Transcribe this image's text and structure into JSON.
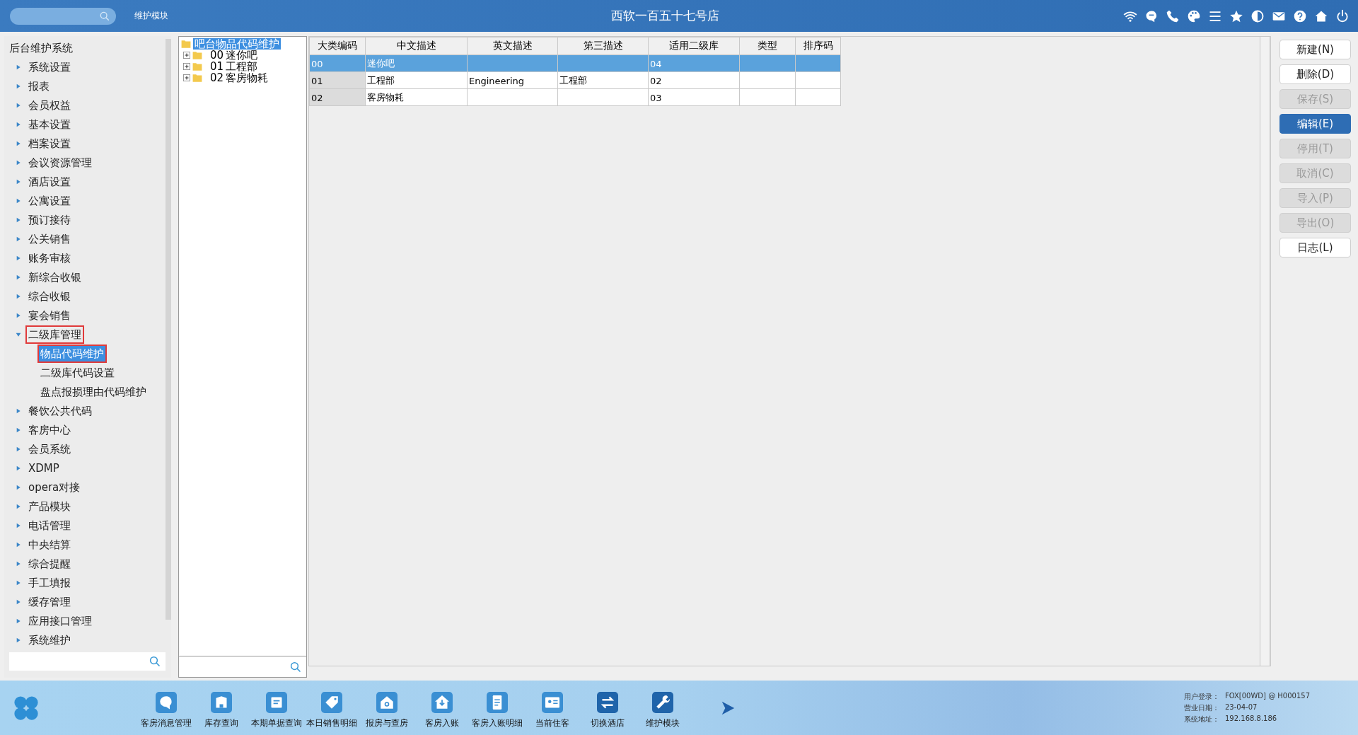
{
  "top_bar": {
    "module": "维护模块",
    "title": "西软一百五十七号店"
  },
  "sidebar": {
    "title": "后台维护系统",
    "items": [
      {
        "label": "系统设置",
        "expanded": false,
        "marked": false
      },
      {
        "label": "报表",
        "expanded": false,
        "marked": false
      },
      {
        "label": "会员权益",
        "expanded": false,
        "marked": false
      },
      {
        "label": "基本设置",
        "expanded": false,
        "marked": false
      },
      {
        "label": "档案设置",
        "expanded": false,
        "marked": false
      },
      {
        "label": "会议资源管理",
        "expanded": false,
        "marked": false
      },
      {
        "label": "酒店设置",
        "expanded": false,
        "marked": false
      },
      {
        "label": "公寓设置",
        "expanded": false,
        "marked": false
      },
      {
        "label": "预订接待",
        "expanded": false,
        "marked": false
      },
      {
        "label": "公关销售",
        "expanded": false,
        "marked": false
      },
      {
        "label": "账务审核",
        "expanded": false,
        "marked": false
      },
      {
        "label": "新综合收银",
        "expanded": false,
        "marked": false
      },
      {
        "label": "综合收银",
        "expanded": false,
        "marked": false
      },
      {
        "label": "宴会销售",
        "expanded": false,
        "marked": false
      },
      {
        "label": "二级库管理",
        "expanded": true,
        "marked": true,
        "children": [
          {
            "label": "物品代码维护",
            "selected": true,
            "marked": true
          },
          {
            "label": "二级库代码设置",
            "selected": false,
            "marked": false
          },
          {
            "label": "盘点报损理由代码维护",
            "selected": false,
            "marked": false
          }
        ]
      },
      {
        "label": "餐饮公共代码",
        "expanded": false,
        "marked": false
      },
      {
        "label": "客房中心",
        "expanded": false,
        "marked": false
      },
      {
        "label": "会员系统",
        "expanded": false,
        "marked": false
      },
      {
        "label": "XDMP",
        "expanded": false,
        "marked": false
      },
      {
        "label": "opera对接",
        "expanded": false,
        "marked": false
      },
      {
        "label": "产品模块",
        "expanded": false,
        "marked": false
      },
      {
        "label": "电话管理",
        "expanded": false,
        "marked": false
      },
      {
        "label": "中央结算",
        "expanded": false,
        "marked": false
      },
      {
        "label": "综合提醒",
        "expanded": false,
        "marked": false
      },
      {
        "label": "手工填报",
        "expanded": false,
        "marked": false
      },
      {
        "label": "缓存管理",
        "expanded": false,
        "marked": false
      },
      {
        "label": "应用接口管理",
        "expanded": false,
        "marked": false
      },
      {
        "label": "系统维护",
        "expanded": false,
        "marked": false
      }
    ]
  },
  "category_tree": {
    "root": {
      "label": "吧台物品代码维护",
      "selected": true
    },
    "children": [
      {
        "code": "00",
        "name": "迷你吧",
        "expanded": false
      },
      {
        "code": "01",
        "name": "工程部",
        "expanded": false
      },
      {
        "code": "02",
        "name": "客房物耗",
        "expanded": false
      }
    ]
  },
  "table": {
    "columns": [
      "大类编码",
      "中文描述",
      "英文描述",
      "第三描述",
      "适用二级库",
      "类型",
      "排序码"
    ],
    "rows": [
      {
        "cells": [
          "00",
          "迷你吧",
          "",
          "",
          "04",
          "",
          ""
        ],
        "selected": true
      },
      {
        "cells": [
          "01",
          "工程部",
          "Engineering",
          "工程部",
          "02",
          "",
          ""
        ],
        "selected": false
      },
      {
        "cells": [
          "02",
          "客房物耗",
          "",
          "",
          "03",
          "",
          ""
        ],
        "selected": false
      }
    ]
  },
  "actions": [
    {
      "label": "新建(N)",
      "disabled": false,
      "selected": false
    },
    {
      "label": "删除(D)",
      "disabled": false,
      "selected": false
    },
    {
      "label": "保存(S)",
      "disabled": true,
      "selected": false
    },
    {
      "label": "编辑(E)",
      "disabled": false,
      "selected": true
    },
    {
      "label": "停用(T)",
      "disabled": true,
      "selected": false
    },
    {
      "label": "取消(C)",
      "disabled": true,
      "selected": false
    },
    {
      "label": "导入(P)",
      "disabled": true,
      "selected": false
    },
    {
      "label": "导出(O)",
      "disabled": true,
      "selected": false
    },
    {
      "label": "日志(L)",
      "disabled": false,
      "selected": false
    }
  ],
  "dock": {
    "items": [
      {
        "label": "客房消息管理"
      },
      {
        "label": "库存查询"
      },
      {
        "label": "本期单据查询"
      },
      {
        "label": "本日销售明细"
      },
      {
        "label": "报房与查房"
      },
      {
        "label": "客房入账"
      },
      {
        "label": "客房入账明细"
      },
      {
        "label": "当前住客"
      },
      {
        "label": "切换酒店"
      },
      {
        "label": "维护模块"
      }
    ],
    "info": [
      {
        "label": "用户登录：",
        "value": "FOX[00WD] @ H000157"
      },
      {
        "label": "营业日期：",
        "value": "23-04-07"
      },
      {
        "label": "系统地址：",
        "value": "192.168.8.186"
      }
    ]
  }
}
